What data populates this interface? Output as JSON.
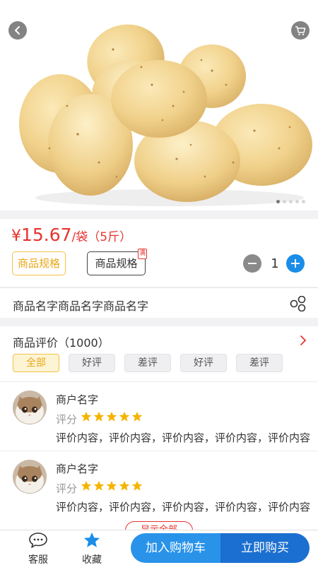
{
  "product": {
    "image_subject": "potatoes",
    "price_currency": "¥",
    "price_value": "15.67",
    "price_unit": "/袋（5斤）",
    "name": "商品名字商品名字商品名字",
    "carousel": {
      "count": 5,
      "active_index": 0
    }
  },
  "specs": [
    {
      "label": "商品规格",
      "selected": true
    },
    {
      "label": "商品规格",
      "selected": false,
      "badge": "满"
    }
  ],
  "quantity": {
    "value": "1"
  },
  "reviews": {
    "title": "商品评价（1000）",
    "filters": [
      "全部",
      "好评",
      "差评",
      "好评",
      "差评"
    ],
    "active_filter_index": 0,
    "items": [
      {
        "merchant": "商户名字",
        "score_label": "评分",
        "rating": 5,
        "content": "评价内容，评价内容，评价内容，评价内容，评价内容"
      },
      {
        "merchant": "商户名字",
        "score_label": "评分",
        "rating": 5,
        "content": "评价内容，评价内容，评价内容，评价内容，评价内容"
      }
    ],
    "more_label": "显示全部"
  },
  "bottom_bar": {
    "service_label": "客服",
    "favorite_label": "收藏",
    "add_to_cart_label": "加入购物车",
    "buy_now_label": "立即购买"
  },
  "icons": {
    "back": "back-chevron-icon",
    "cart": "cart-icon",
    "share": "share-icon",
    "arrow": "chevron-right-icon",
    "service": "chat-bubble-icon",
    "favorite": "star-icon"
  },
  "colors": {
    "price_red": "#e8332f",
    "accent_yellow": "#f2c244",
    "blue_primary": "#2993ea",
    "blue_dark": "#1b6fd0",
    "star": "#f5b400"
  }
}
